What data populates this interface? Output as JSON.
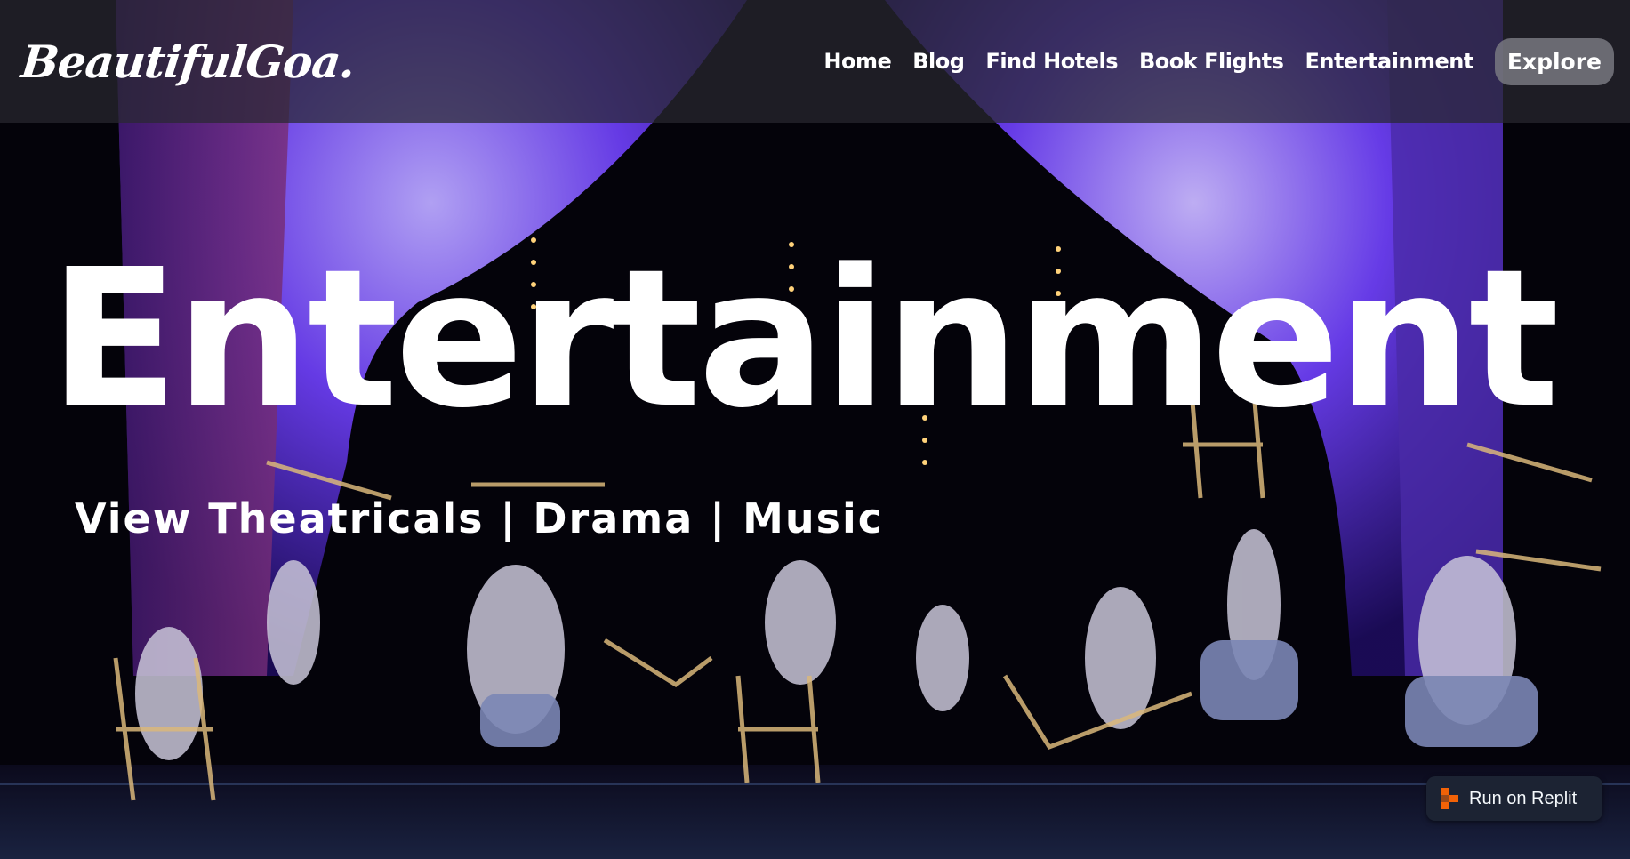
{
  "brand": {
    "logo_text": "BeautifulGoa."
  },
  "nav": {
    "items": [
      {
        "label": "Home"
      },
      {
        "label": "Blog"
      },
      {
        "label": "Find Hotels"
      },
      {
        "label": "Book Flights"
      },
      {
        "label": "Entertainment"
      }
    ],
    "cta_label": "Explore"
  },
  "hero": {
    "title": "Entertainment",
    "subtitle": "View Theatricals | Drama | Music",
    "background": "stage-performance-photo"
  },
  "replit_badge": {
    "label": "Run on Replit",
    "icon": "replit-icon",
    "accent": "#f26207"
  },
  "colors": {
    "nav_bg": "#2a2a30",
    "curtain": "#6d4cff",
    "text": "#ffffff"
  }
}
